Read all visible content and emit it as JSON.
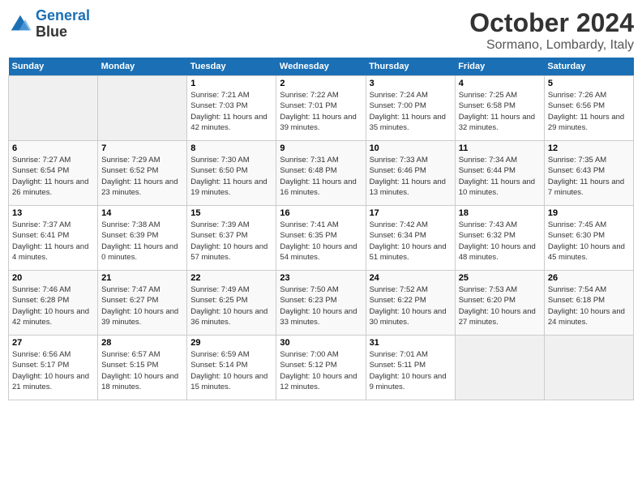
{
  "header": {
    "logo_line1": "General",
    "logo_line2": "Blue",
    "month": "October 2024",
    "location": "Sormano, Lombardy, Italy"
  },
  "days_of_week": [
    "Sunday",
    "Monday",
    "Tuesday",
    "Wednesday",
    "Thursday",
    "Friday",
    "Saturday"
  ],
  "weeks": [
    [
      {
        "num": "",
        "empty": true
      },
      {
        "num": "",
        "empty": true
      },
      {
        "num": "1",
        "sunrise": "Sunrise: 7:21 AM",
        "sunset": "Sunset: 7:03 PM",
        "daylight": "Daylight: 11 hours and 42 minutes."
      },
      {
        "num": "2",
        "sunrise": "Sunrise: 7:22 AM",
        "sunset": "Sunset: 7:01 PM",
        "daylight": "Daylight: 11 hours and 39 minutes."
      },
      {
        "num": "3",
        "sunrise": "Sunrise: 7:24 AM",
        "sunset": "Sunset: 7:00 PM",
        "daylight": "Daylight: 11 hours and 35 minutes."
      },
      {
        "num": "4",
        "sunrise": "Sunrise: 7:25 AM",
        "sunset": "Sunset: 6:58 PM",
        "daylight": "Daylight: 11 hours and 32 minutes."
      },
      {
        "num": "5",
        "sunrise": "Sunrise: 7:26 AM",
        "sunset": "Sunset: 6:56 PM",
        "daylight": "Daylight: 11 hours and 29 minutes."
      }
    ],
    [
      {
        "num": "6",
        "sunrise": "Sunrise: 7:27 AM",
        "sunset": "Sunset: 6:54 PM",
        "daylight": "Daylight: 11 hours and 26 minutes."
      },
      {
        "num": "7",
        "sunrise": "Sunrise: 7:29 AM",
        "sunset": "Sunset: 6:52 PM",
        "daylight": "Daylight: 11 hours and 23 minutes."
      },
      {
        "num": "8",
        "sunrise": "Sunrise: 7:30 AM",
        "sunset": "Sunset: 6:50 PM",
        "daylight": "Daylight: 11 hours and 19 minutes."
      },
      {
        "num": "9",
        "sunrise": "Sunrise: 7:31 AM",
        "sunset": "Sunset: 6:48 PM",
        "daylight": "Daylight: 11 hours and 16 minutes."
      },
      {
        "num": "10",
        "sunrise": "Sunrise: 7:33 AM",
        "sunset": "Sunset: 6:46 PM",
        "daylight": "Daylight: 11 hours and 13 minutes."
      },
      {
        "num": "11",
        "sunrise": "Sunrise: 7:34 AM",
        "sunset": "Sunset: 6:44 PM",
        "daylight": "Daylight: 11 hours and 10 minutes."
      },
      {
        "num": "12",
        "sunrise": "Sunrise: 7:35 AM",
        "sunset": "Sunset: 6:43 PM",
        "daylight": "Daylight: 11 hours and 7 minutes."
      }
    ],
    [
      {
        "num": "13",
        "sunrise": "Sunrise: 7:37 AM",
        "sunset": "Sunset: 6:41 PM",
        "daylight": "Daylight: 11 hours and 4 minutes."
      },
      {
        "num": "14",
        "sunrise": "Sunrise: 7:38 AM",
        "sunset": "Sunset: 6:39 PM",
        "daylight": "Daylight: 11 hours and 0 minutes."
      },
      {
        "num": "15",
        "sunrise": "Sunrise: 7:39 AM",
        "sunset": "Sunset: 6:37 PM",
        "daylight": "Daylight: 10 hours and 57 minutes."
      },
      {
        "num": "16",
        "sunrise": "Sunrise: 7:41 AM",
        "sunset": "Sunset: 6:35 PM",
        "daylight": "Daylight: 10 hours and 54 minutes."
      },
      {
        "num": "17",
        "sunrise": "Sunrise: 7:42 AM",
        "sunset": "Sunset: 6:34 PM",
        "daylight": "Daylight: 10 hours and 51 minutes."
      },
      {
        "num": "18",
        "sunrise": "Sunrise: 7:43 AM",
        "sunset": "Sunset: 6:32 PM",
        "daylight": "Daylight: 10 hours and 48 minutes."
      },
      {
        "num": "19",
        "sunrise": "Sunrise: 7:45 AM",
        "sunset": "Sunset: 6:30 PM",
        "daylight": "Daylight: 10 hours and 45 minutes."
      }
    ],
    [
      {
        "num": "20",
        "sunrise": "Sunrise: 7:46 AM",
        "sunset": "Sunset: 6:28 PM",
        "daylight": "Daylight: 10 hours and 42 minutes."
      },
      {
        "num": "21",
        "sunrise": "Sunrise: 7:47 AM",
        "sunset": "Sunset: 6:27 PM",
        "daylight": "Daylight: 10 hours and 39 minutes."
      },
      {
        "num": "22",
        "sunrise": "Sunrise: 7:49 AM",
        "sunset": "Sunset: 6:25 PM",
        "daylight": "Daylight: 10 hours and 36 minutes."
      },
      {
        "num": "23",
        "sunrise": "Sunrise: 7:50 AM",
        "sunset": "Sunset: 6:23 PM",
        "daylight": "Daylight: 10 hours and 33 minutes."
      },
      {
        "num": "24",
        "sunrise": "Sunrise: 7:52 AM",
        "sunset": "Sunset: 6:22 PM",
        "daylight": "Daylight: 10 hours and 30 minutes."
      },
      {
        "num": "25",
        "sunrise": "Sunrise: 7:53 AM",
        "sunset": "Sunset: 6:20 PM",
        "daylight": "Daylight: 10 hours and 27 minutes."
      },
      {
        "num": "26",
        "sunrise": "Sunrise: 7:54 AM",
        "sunset": "Sunset: 6:18 PM",
        "daylight": "Daylight: 10 hours and 24 minutes."
      }
    ],
    [
      {
        "num": "27",
        "sunrise": "Sunrise: 6:56 AM",
        "sunset": "Sunset: 5:17 PM",
        "daylight": "Daylight: 10 hours and 21 minutes."
      },
      {
        "num": "28",
        "sunrise": "Sunrise: 6:57 AM",
        "sunset": "Sunset: 5:15 PM",
        "daylight": "Daylight: 10 hours and 18 minutes."
      },
      {
        "num": "29",
        "sunrise": "Sunrise: 6:59 AM",
        "sunset": "Sunset: 5:14 PM",
        "daylight": "Daylight: 10 hours and 15 minutes."
      },
      {
        "num": "30",
        "sunrise": "Sunrise: 7:00 AM",
        "sunset": "Sunset: 5:12 PM",
        "daylight": "Daylight: 10 hours and 12 minutes."
      },
      {
        "num": "31",
        "sunrise": "Sunrise: 7:01 AM",
        "sunset": "Sunset: 5:11 PM",
        "daylight": "Daylight: 10 hours and 9 minutes."
      },
      {
        "num": "",
        "empty": true
      },
      {
        "num": "",
        "empty": true
      }
    ]
  ]
}
